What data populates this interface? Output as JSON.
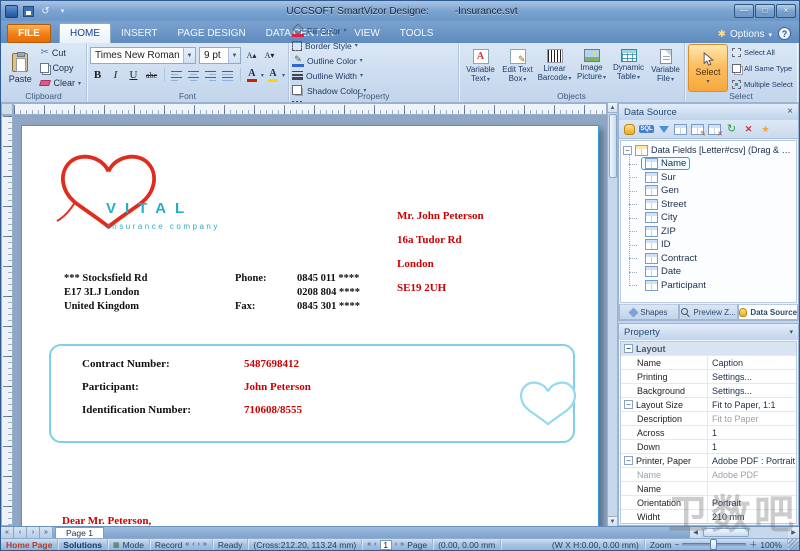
{
  "window": {
    "app_title": "UCCSOFT SmartVizor Designe:",
    "doc_title": "-Insurance.svt"
  },
  "tabs": {
    "file_label": "FILE",
    "items": [
      "HOME",
      "INSERT",
      "PAGE DESIGN",
      "DATA CENTER",
      "VIEW",
      "TOOLS"
    ],
    "options_label": "Options",
    "help_label": "?"
  },
  "ribbon": {
    "clipboard": {
      "label": "Clipboard",
      "paste": "Paste",
      "cut": "Cut",
      "copy": "Copy",
      "clear": "Clear"
    },
    "font": {
      "label": "Font",
      "family": "Times New Roman",
      "size": "9 pt",
      "bold": "B",
      "italic": "I",
      "underline": "U",
      "strike": "abc",
      "grow": "A",
      "shrink": "A",
      "color_a": "A",
      "highlight_a": "A"
    },
    "property_group": {
      "label": "Property",
      "items": [
        "Fill Color",
        "Border Style",
        "Outline Color",
        "Outline Width",
        "Shadow Color",
        "Outline Style"
      ]
    },
    "objects": {
      "label": "Objects",
      "items": [
        "Variable Text",
        "Edit Text Box",
        "Linear Barcode",
        "Image Picture",
        "Dynamic Table",
        "Variable File"
      ]
    },
    "select_group": {
      "label": "Select",
      "main": "Select",
      "items": [
        "Select All",
        "All Same Type",
        "Multiple Select"
      ]
    }
  },
  "document": {
    "logo": {
      "name": "VITAL",
      "subtitle": "insurance company"
    },
    "recipient": [
      "Mr. John Peterson",
      "16a Tudor Rd",
      "London",
      "SE19 2UH"
    ],
    "sender": [
      "*** Stocksfield Rd",
      "E17 3LJ London",
      "United Kingdom"
    ],
    "phone_label": "Phone:",
    "fax_label": "Fax:",
    "phones": [
      "0845 011 ****",
      "0208 804 ****",
      "0845 301 ****"
    ],
    "fields": [
      {
        "label": "Contract Number:",
        "value": "5487698412"
      },
      {
        "label": "Participant:",
        "value": "John Peterson"
      },
      {
        "label": "Identification Number:",
        "value": "710608/8555"
      }
    ],
    "salutation": "Dear  Mr. Peterson,"
  },
  "datasource": {
    "title": "Data Source",
    "sql_icon_text": "SQL",
    "root_label": "Data Fields [Letter#csv] (Drag & Drop)",
    "fields": [
      "Name",
      "Sur",
      "Gen",
      "Street",
      "City",
      "ZIP",
      "ID",
      "Contract",
      "Date",
      "Participant"
    ],
    "tabs": [
      "Shapes",
      "Preview Z...",
      "Data Source"
    ],
    "active_tab": "Data Source"
  },
  "property_panel": {
    "title": "Property",
    "rows": [
      {
        "label": "Layout",
        "value": ""
      },
      {
        "label": "Name",
        "value": "Caption"
      },
      {
        "label": "Printing",
        "value": "Settings..."
      },
      {
        "label": "Background",
        "value": "Settings..."
      },
      {
        "label": "Layout Size",
        "value": "Fit to Paper, 1:1"
      },
      {
        "label": "Description",
        "value": "Fit to Paper"
      },
      {
        "label": "Across",
        "value": "1"
      },
      {
        "label": "Down",
        "value": "1"
      },
      {
        "label": "Printer, Paper",
        "value": "Adobe PDF : Portrait"
      },
      {
        "label": "Name",
        "value": "Adobe PDF"
      },
      {
        "label": "Name",
        "value": ""
      },
      {
        "label": "Orientation",
        "value": "Portrait"
      },
      {
        "label": "Widht",
        "value": "210 mm"
      }
    ]
  },
  "pagebar": {
    "tab_label": "Page 1"
  },
  "statusbar": {
    "home_page": "Home Page",
    "solutions": "Solutions",
    "mode": "Mode",
    "record": "Record",
    "ready": "Ready",
    "cross": "(Cross:212.20, 113.24 mm)",
    "origin": "(0.00, 0.00 mm",
    "page_label": "Page",
    "page_number": "1",
    "wxh": "(W X H:0.00, 0.00 mm)",
    "zoom_label": "Zoom",
    "zoom_value": "100%"
  },
  "watermark": {
    "text": "卫数吧"
  },
  "colors": {
    "red_text": "#cc0000",
    "brand_teal": "#27aec6",
    "file_tab_orange": "#f07d12",
    "select_button_orange": "#f8a83c",
    "page_border_blue": "#3d9bd5"
  }
}
